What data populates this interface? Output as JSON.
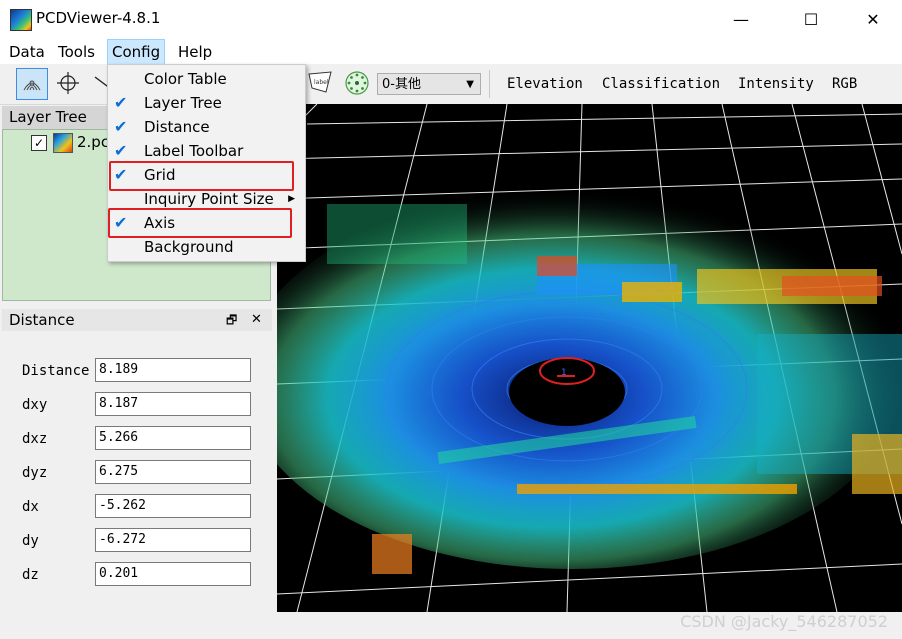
{
  "window": {
    "title": "PCDViewer-4.8.1",
    "minimize_glyph": "—",
    "maximize_glyph": "☐",
    "close_glyph": "✕"
  },
  "menu": {
    "items": [
      {
        "label": "Data"
      },
      {
        "label": "Tools"
      },
      {
        "label": "Config"
      },
      {
        "label": "Help"
      }
    ]
  },
  "toolbar": {
    "icons": [
      "point-cloud-icon",
      "crosshair-icon",
      "measure-line-icon",
      "label-icon",
      "sphere-icon"
    ],
    "label_icon_text": "label",
    "class_select": {
      "value": "0-其他"
    },
    "color_modes": [
      {
        "label": "Elevation"
      },
      {
        "label": "Classification"
      },
      {
        "label": "Intensity"
      },
      {
        "label": "RGB"
      }
    ]
  },
  "layer_tree": {
    "title": "Layer Tree",
    "items": [
      {
        "label": "2.pc",
        "checked": true
      }
    ]
  },
  "distance_panel": {
    "title": "Distance",
    "restore_glyph": "🗗",
    "close_glyph": "✕",
    "rows": [
      {
        "label": "Distance",
        "value": "8.189"
      },
      {
        "label": "dxy",
        "value": "8.187"
      },
      {
        "label": "dxz",
        "value": "5.266"
      },
      {
        "label": "dyz",
        "value": "6.275"
      },
      {
        "label": "dx",
        "value": "-5.262"
      },
      {
        "label": "dy",
        "value": "-6.272"
      },
      {
        "label": "dz",
        "value": "0.201"
      }
    ]
  },
  "config_menu": {
    "items": [
      {
        "label": "Color Table",
        "checked": false,
        "submenu": false,
        "highlighted": false
      },
      {
        "label": "Layer Tree",
        "checked": true,
        "submenu": false,
        "highlighted": false
      },
      {
        "label": "Distance",
        "checked": true,
        "submenu": false,
        "highlighted": false
      },
      {
        "label": "Label Toolbar",
        "checked": true,
        "submenu": false,
        "highlighted": false
      },
      {
        "label": "Grid",
        "checked": true,
        "submenu": false,
        "highlighted": true
      },
      {
        "label": "Inquiry Point Size",
        "checked": false,
        "submenu": true,
        "highlighted": false
      },
      {
        "label": "Axis",
        "checked": true,
        "submenu": false,
        "highlighted": true
      },
      {
        "label": "Background",
        "checked": false,
        "submenu": false,
        "highlighted": false
      }
    ],
    "check_glyph": "✔",
    "submenu_glyph": "▶"
  },
  "viewport": {
    "background": "#000000",
    "grid_color": "#ffffff",
    "annotation_color": "#e02020",
    "axis_label": "1"
  },
  "watermark": "CSDN @Jacky_546287052"
}
